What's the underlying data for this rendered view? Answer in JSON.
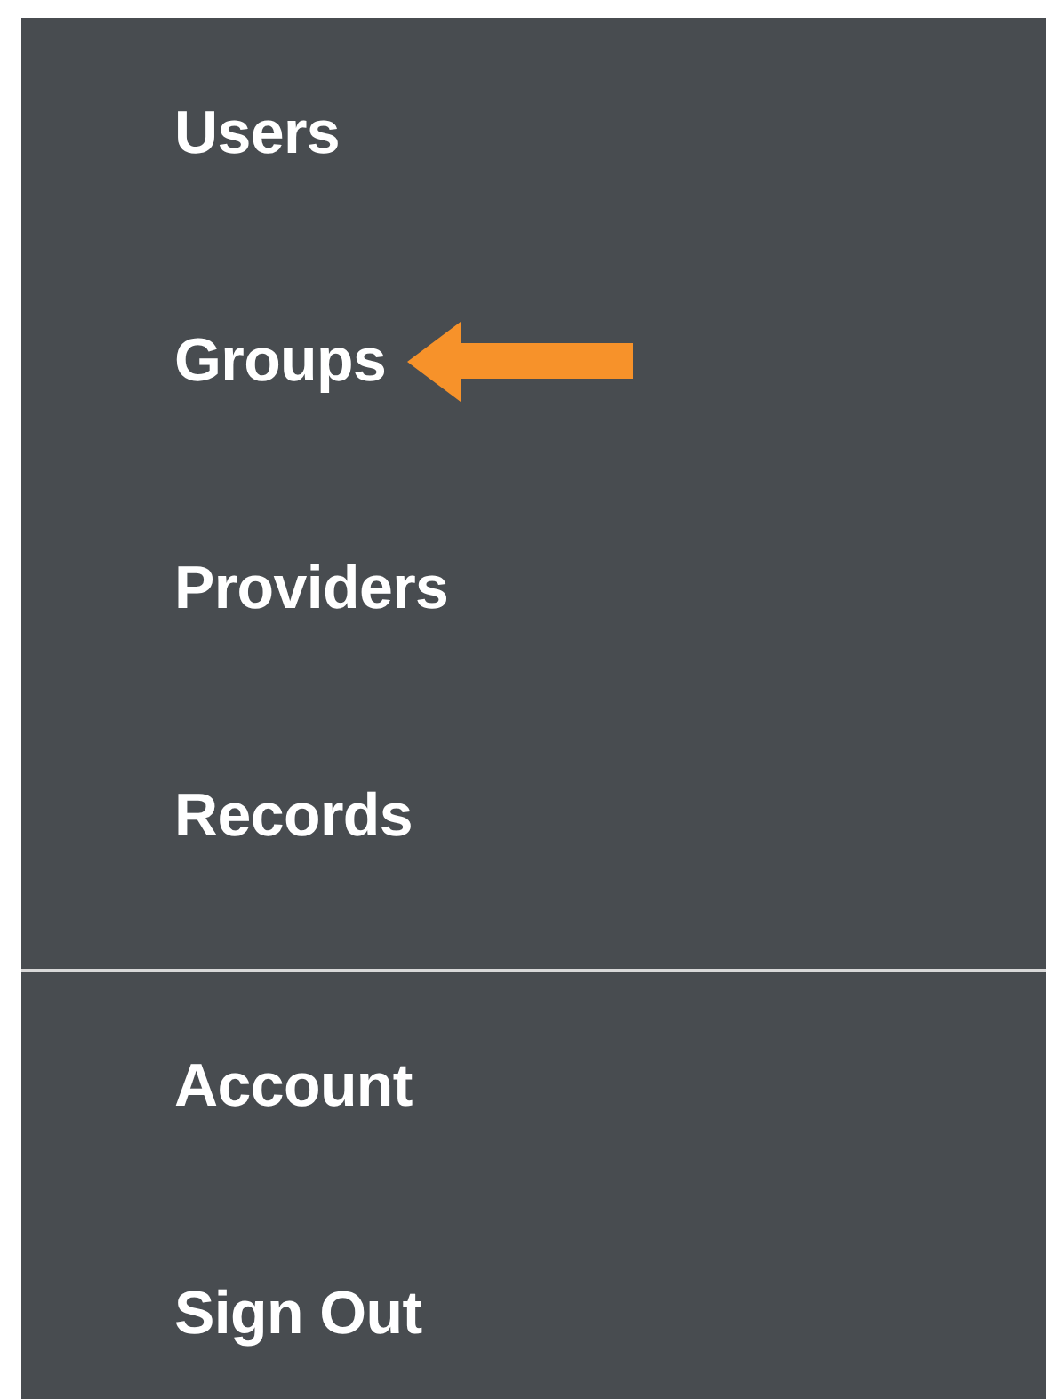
{
  "menu": {
    "sections": [
      {
        "items": [
          {
            "label": "Users",
            "highlighted": false
          },
          {
            "label": "Groups",
            "highlighted": true
          },
          {
            "label": "Providers",
            "highlighted": false
          },
          {
            "label": "Records",
            "highlighted": false
          }
        ]
      },
      {
        "items": [
          {
            "label": "Account",
            "highlighted": false
          },
          {
            "label": "Sign Out",
            "highlighted": false
          }
        ]
      }
    ]
  }
}
